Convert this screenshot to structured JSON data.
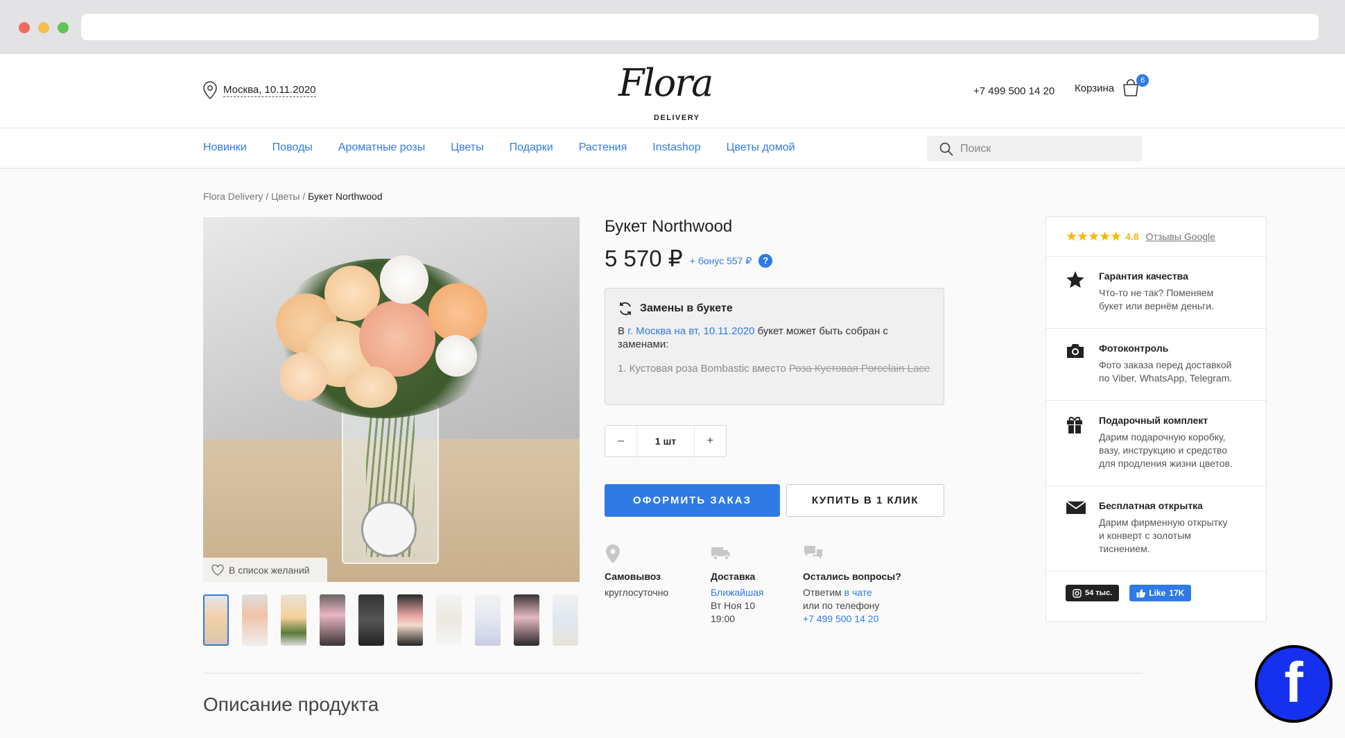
{
  "location": {
    "label": "Москва, 10.11.2020",
    "icon": "location-pin-icon"
  },
  "logo": {
    "script": "Flora",
    "sub": "DELIVERY"
  },
  "header": {
    "phone": "+7 499 500 14 20",
    "cart_label": "Корзина",
    "cart_count": "6"
  },
  "nav": {
    "items": [
      {
        "label": "Новинки"
      },
      {
        "label": "Поводы"
      },
      {
        "label": "Ароматные розы"
      },
      {
        "label": "Цветы"
      },
      {
        "label": "Подарки"
      },
      {
        "label": "Растения"
      },
      {
        "label": "Instashop"
      },
      {
        "label": "Цветы домой"
      }
    ],
    "search_placeholder": "Поиск"
  },
  "breadcrumb": {
    "root": "Flora Delivery",
    "sep1": " / ",
    "section": "Цветы",
    "sep2": " / ",
    "current": "Букет Northwood"
  },
  "gallery": {
    "wishlist_label": "В список желаний",
    "thumb_count": 10,
    "active_thumb": 1
  },
  "product": {
    "title": "Букет Northwood",
    "price": "5 570 ₽",
    "bonus": "+ бонус 557 ₽",
    "help": "?",
    "replacements": {
      "title": "Замены в букете",
      "text_prefix": "В ",
      "text_link": "г. Москва на вт, 10.11.2020",
      "text_suffix": " букет может быть собран с заменами:",
      "item_prefix": "1. Кустовая роза Bombastic вместо ",
      "item_struck": "Роза Кустовая Porcelain Lace"
    },
    "qty": {
      "minus": "–",
      "value": "1 шт",
      "plus": "+"
    },
    "order_button": "ОФОРМИТЬ ЗАКАЗ",
    "one_click_button": "КУПИТЬ В 1 КЛИК"
  },
  "delivery_info": {
    "pickup": {
      "title": "Самовывоз",
      "text": "круглосуточно"
    },
    "delivery": {
      "title": "Доставка",
      "link": "Ближайшая",
      "line2": "Вт Ноя 10",
      "line3": "19:00"
    },
    "questions": {
      "title": "Остались вопросы?",
      "line1_prefix": "Ответим ",
      "line1_link": "в чате",
      "line2": "или по телефону",
      "phone": "+7 499 500 14 20"
    }
  },
  "panel": {
    "rating": {
      "stars": "★★★★★",
      "value": "4.8",
      "link": "Отзывы Google"
    },
    "features": [
      {
        "icon": "star-icon",
        "title": "Гарантия качества",
        "lines": [
          "Что-то не так? Поменяем",
          "букет или вернём деньги."
        ]
      },
      {
        "icon": "camera-icon",
        "title": "Фотоконтроль",
        "lines": [
          "Фото заказа перед доставкой",
          "по Viber, WhatsApp, Telegram."
        ]
      },
      {
        "icon": "gift-icon",
        "title": "Подарочный комплект",
        "lines": [
          "Дарим подарочную коробку,",
          "вазу, инструкцию и средство",
          "для продления жизни цветов."
        ]
      },
      {
        "icon": "envelope-icon",
        "title": "Бесплатная открытка",
        "lines": [
          "Дарим фирменную открытку",
          "и конверт с золотым",
          "тиснением."
        ]
      }
    ],
    "instagram": "54 тыс.",
    "facebook": {
      "label": "Like",
      "count": "17K"
    }
  },
  "description_title": "Описание продукта",
  "floating": {
    "facebook_glyph": "f"
  },
  "colors": {
    "accent": "#2f7ae5",
    "star": "#f5b70f",
    "fab": "#1630f0"
  }
}
